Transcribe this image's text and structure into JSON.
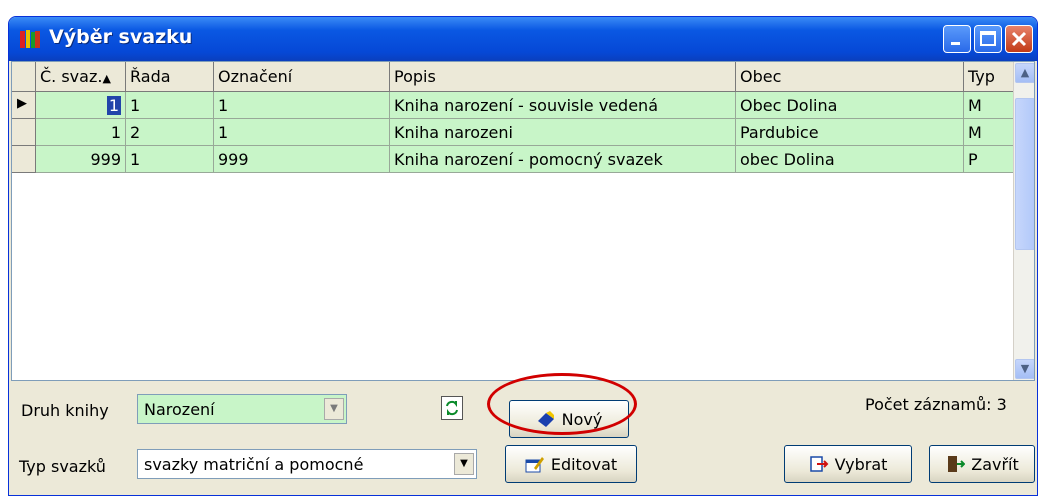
{
  "window": {
    "title": "Výběr svazku"
  },
  "grid": {
    "columns": [
      "Č. svaz.",
      "Řada",
      "Označení",
      "Popis",
      "Obec",
      "Typ"
    ],
    "sort_indicator": "▲",
    "rows": [
      {
        "c0": "1",
        "c1": "1",
        "c2": "1",
        "c3": "Kniha narození - souvisle vedená",
        "c4": "Obec Dolina",
        "c5": "M"
      },
      {
        "c0": "1",
        "c1": "2",
        "c2": "1",
        "c3": "Kniha narozeni",
        "c4": "Pardubice",
        "c5": "M"
      },
      {
        "c0": "999",
        "c1": "1",
        "c2": "999",
        "c3": "Kniha narození - pomocný svazek",
        "c4": "obec Dolina",
        "c5": "P"
      }
    ],
    "current_row_marker": "▶"
  },
  "footer": {
    "druh_label": "Druh knihy",
    "druh_value": "Narození",
    "typ_label": "Typ svazků",
    "typ_value": "svazky matriční a pomocné",
    "count_text": "Počet záznamů: 3",
    "novy_label": "Nový",
    "editovat_label": "Editovat",
    "vybrat_label": "Vybrat",
    "zavrit_label": "Zavřít"
  },
  "colors": {
    "row_bg": "#c8f5c8",
    "title_bg": "#0648d6",
    "highlight_ring": "#d10000"
  },
  "icons": [
    "books-icon",
    "minimize-icon",
    "maximize-icon",
    "close-icon",
    "refresh-icon",
    "new-record-icon",
    "edit-icon",
    "select-icon",
    "exit-icon"
  ]
}
